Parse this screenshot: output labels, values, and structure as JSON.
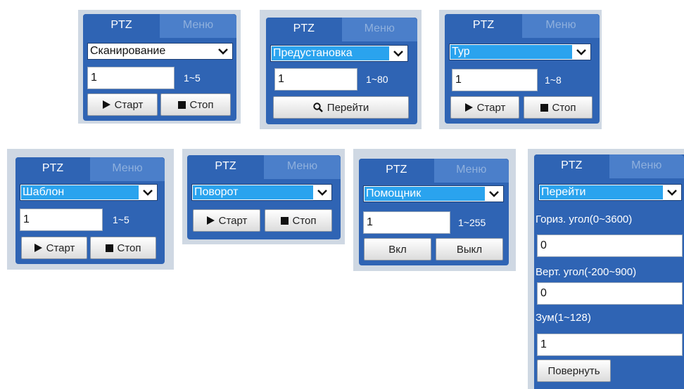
{
  "panels": {
    "scan": {
      "tab_ptz": "PTZ",
      "tab_menu": "Меню",
      "mode": "Сканирование",
      "value": "1",
      "range": "1~5",
      "start": "Старт",
      "stop": "Стоп"
    },
    "preset": {
      "tab_ptz": "PTZ",
      "tab_menu": "Меню",
      "mode": "Предустановка",
      "value": "1",
      "range": "1~80",
      "go": "Перейти"
    },
    "tour": {
      "tab_ptz": "PTZ",
      "tab_menu": "Меню",
      "mode": "Тур",
      "value": "1",
      "range": "1~8",
      "start": "Старт",
      "stop": "Стоп"
    },
    "pattern": {
      "tab_ptz": "PTZ",
      "tab_menu": "Меню",
      "mode": "Шаблон",
      "value": "1",
      "range": "1~5",
      "start": "Старт",
      "stop": "Стоп"
    },
    "rotate": {
      "tab_ptz": "PTZ",
      "tab_menu": "Меню",
      "mode": "Поворот",
      "start": "Старт",
      "stop": "Стоп"
    },
    "assist": {
      "tab_ptz": "PTZ",
      "tab_menu": "Меню",
      "mode": "Помощник",
      "value": "1",
      "range": "1~255",
      "on": "Вкл",
      "off": "Выкл"
    },
    "goto": {
      "tab_ptz": "PTZ",
      "tab_menu": "Меню",
      "mode": "Перейти",
      "pan_label": "Гориз. угол(0~3600)",
      "pan_value": "0",
      "tilt_label": "Верт. угол(-200~900)",
      "tilt_value": "0",
      "zoom_label": "Зум(1~128)",
      "zoom_value": "1",
      "rotate_btn": "Повернуть"
    }
  },
  "icons": {
    "play": "play-icon",
    "stop": "stop-square-icon",
    "search": "search-icon",
    "dropdown": "chevron-down-icon"
  }
}
